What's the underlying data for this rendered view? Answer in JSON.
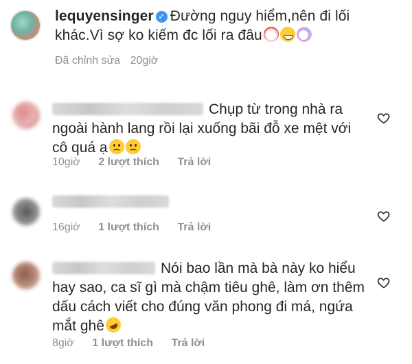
{
  "post": {
    "username": "lequyensinger",
    "caption": "Đường nguy hiểm,nên đi lối khác.Vì sợ ko kiếm đc lối ra đâu",
    "edited_label": "Đã chỉnh sửa",
    "time": "20giờ"
  },
  "comments": [
    {
      "text": "Chụp từ trong nhà ra ngoài hành lang rồi lại xuống bãi đỗ xe mệt với cô quá ạ",
      "time": "10giờ",
      "likes": "2 lượt thích",
      "reply": "Trả lời"
    },
    {
      "text": "",
      "time": "16giờ",
      "likes": "1 lượt thích",
      "reply": "Trả lời"
    },
    {
      "text": "Nói bao lần mà bà này ko hiểu hay sao, ca sĩ gì mà chậm tiêu ghê, làm ơn thêm dấu cách viết cho đúng văn phong đi má, ngứa mắt ghê",
      "time": "8giờ",
      "likes": "1 lượt thích",
      "reply": "Trả lời"
    }
  ],
  "colors": {
    "text": "#262626",
    "meta": "#8e8e8e",
    "verified": "#3897f0"
  },
  "icons": [
    "verified-badge-icon",
    "heart-icon",
    "clown-emoji",
    "grin-sweat-emoji",
    "unicorn-emoji",
    "sad-emoji",
    "rofl-emoji"
  ]
}
